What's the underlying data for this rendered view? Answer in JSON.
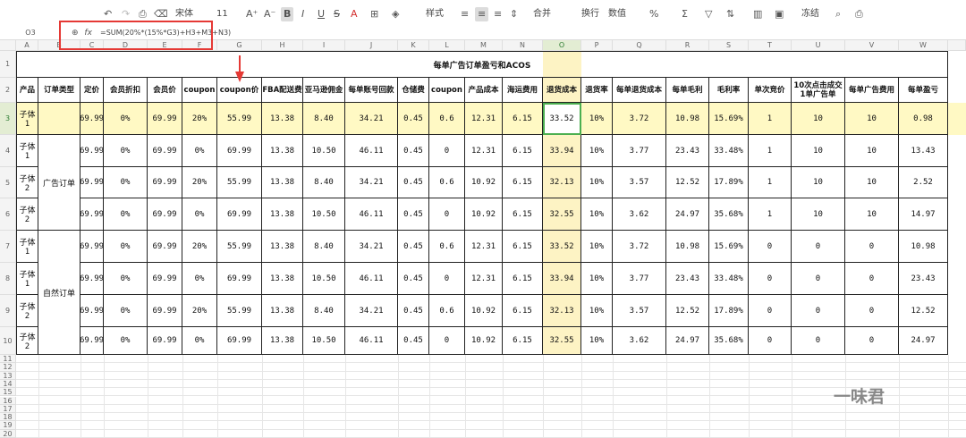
{
  "toolbar": {
    "font_name": "宋体",
    "font_size": "11",
    "style_label": "样式",
    "merge_label": "合并",
    "wrap_label": "换行",
    "number_format": "数值",
    "freeze_label": "冻结"
  },
  "formula_bar": {
    "cell_ref": "O3",
    "fx": "fx",
    "formula": "=SUM(20%*(15%*G3)+H3+M3+N3)"
  },
  "columns": [
    "A",
    "B",
    "C",
    "D",
    "E",
    "F",
    "G",
    "H",
    "I",
    "J",
    "K",
    "L",
    "M",
    "N",
    "O",
    "P",
    "Q",
    "R",
    "S",
    "T",
    "U",
    "V",
    "W"
  ],
  "row_numbers": [
    "1",
    "2",
    "3",
    "4",
    "5",
    "6",
    "7",
    "8",
    "9",
    "10",
    "11",
    "12",
    "13",
    "14",
    "15",
    "16",
    "17",
    "18",
    "19",
    "20"
  ],
  "sheet": {
    "title": "每单广告订单盈亏和ACOS",
    "headers": [
      "产品",
      "订单类型",
      "定价",
      "会员折扣",
      "会员价",
      "coupon",
      "coupon价",
      "FBA配送费",
      "亚马逊佣金",
      "每单账号回款",
      "仓储费",
      "coupon",
      "产品成本",
      "海运费用",
      "退货成本",
      "退货率",
      "每单退货成本",
      "每单毛利",
      "毛利率",
      "单次竞价",
      "10次点击成交1单广告单",
      "每单广告费用",
      "每单盈亏"
    ],
    "order_types": [
      "广告订单",
      "自然订单"
    ],
    "rows": [
      [
        "子体1",
        "",
        "69.99",
        "0%",
        "69.99",
        "20%",
        "55.99",
        "13.38",
        "8.40",
        "34.21",
        "0.45",
        "0.6",
        "12.31",
        "6.15",
        "33.52",
        "10%",
        "3.72",
        "10.98",
        "15.69%",
        "1",
        "10",
        "10",
        "0.98"
      ],
      [
        "子体1",
        "",
        "69.99",
        "0%",
        "69.99",
        "0%",
        "69.99",
        "13.38",
        "10.50",
        "46.11",
        "0.45",
        "0",
        "12.31",
        "6.15",
        "33.94",
        "10%",
        "3.77",
        "23.43",
        "33.48%",
        "1",
        "10",
        "10",
        "13.43"
      ],
      [
        "子体2",
        "",
        "69.99",
        "0%",
        "69.99",
        "20%",
        "55.99",
        "13.38",
        "8.40",
        "34.21",
        "0.45",
        "0.6",
        "10.92",
        "6.15",
        "32.13",
        "10%",
        "3.57",
        "12.52",
        "17.89%",
        "1",
        "10",
        "10",
        "2.52"
      ],
      [
        "子体2",
        "",
        "69.99",
        "0%",
        "69.99",
        "0%",
        "69.99",
        "13.38",
        "10.50",
        "46.11",
        "0.45",
        "0",
        "10.92",
        "6.15",
        "32.55",
        "10%",
        "3.62",
        "24.97",
        "35.68%",
        "1",
        "10",
        "10",
        "14.97"
      ],
      [
        "子体1",
        "",
        "69.99",
        "0%",
        "69.99",
        "20%",
        "55.99",
        "13.38",
        "8.40",
        "34.21",
        "0.45",
        "0.6",
        "12.31",
        "6.15",
        "33.52",
        "10%",
        "3.72",
        "10.98",
        "15.69%",
        "0",
        "0",
        "0",
        "10.98"
      ],
      [
        "子体1",
        "",
        "69.99",
        "0%",
        "69.99",
        "0%",
        "69.99",
        "13.38",
        "10.50",
        "46.11",
        "0.45",
        "0",
        "12.31",
        "6.15",
        "33.94",
        "10%",
        "3.77",
        "23.43",
        "33.48%",
        "0",
        "0",
        "0",
        "23.43"
      ],
      [
        "子体2",
        "",
        "69.99",
        "0%",
        "69.99",
        "20%",
        "55.99",
        "13.38",
        "8.40",
        "34.21",
        "0.45",
        "0.6",
        "10.92",
        "6.15",
        "32.13",
        "10%",
        "3.57",
        "12.52",
        "17.89%",
        "0",
        "0",
        "0",
        "12.52"
      ],
      [
        "子体2",
        "",
        "69.99",
        "0%",
        "69.99",
        "0%",
        "69.99",
        "13.38",
        "10.50",
        "46.11",
        "0.45",
        "0",
        "10.92",
        "6.15",
        "32.55",
        "10%",
        "3.62",
        "24.97",
        "35.68%",
        "0",
        "0",
        "0",
        "24.97"
      ]
    ]
  },
  "watermark": "一味君",
  "colors": {
    "highlight_row": "#fff9c4",
    "selected_col": "#fdf3c4",
    "red_box": "#e53935",
    "active_cell": "#4caf50"
  }
}
